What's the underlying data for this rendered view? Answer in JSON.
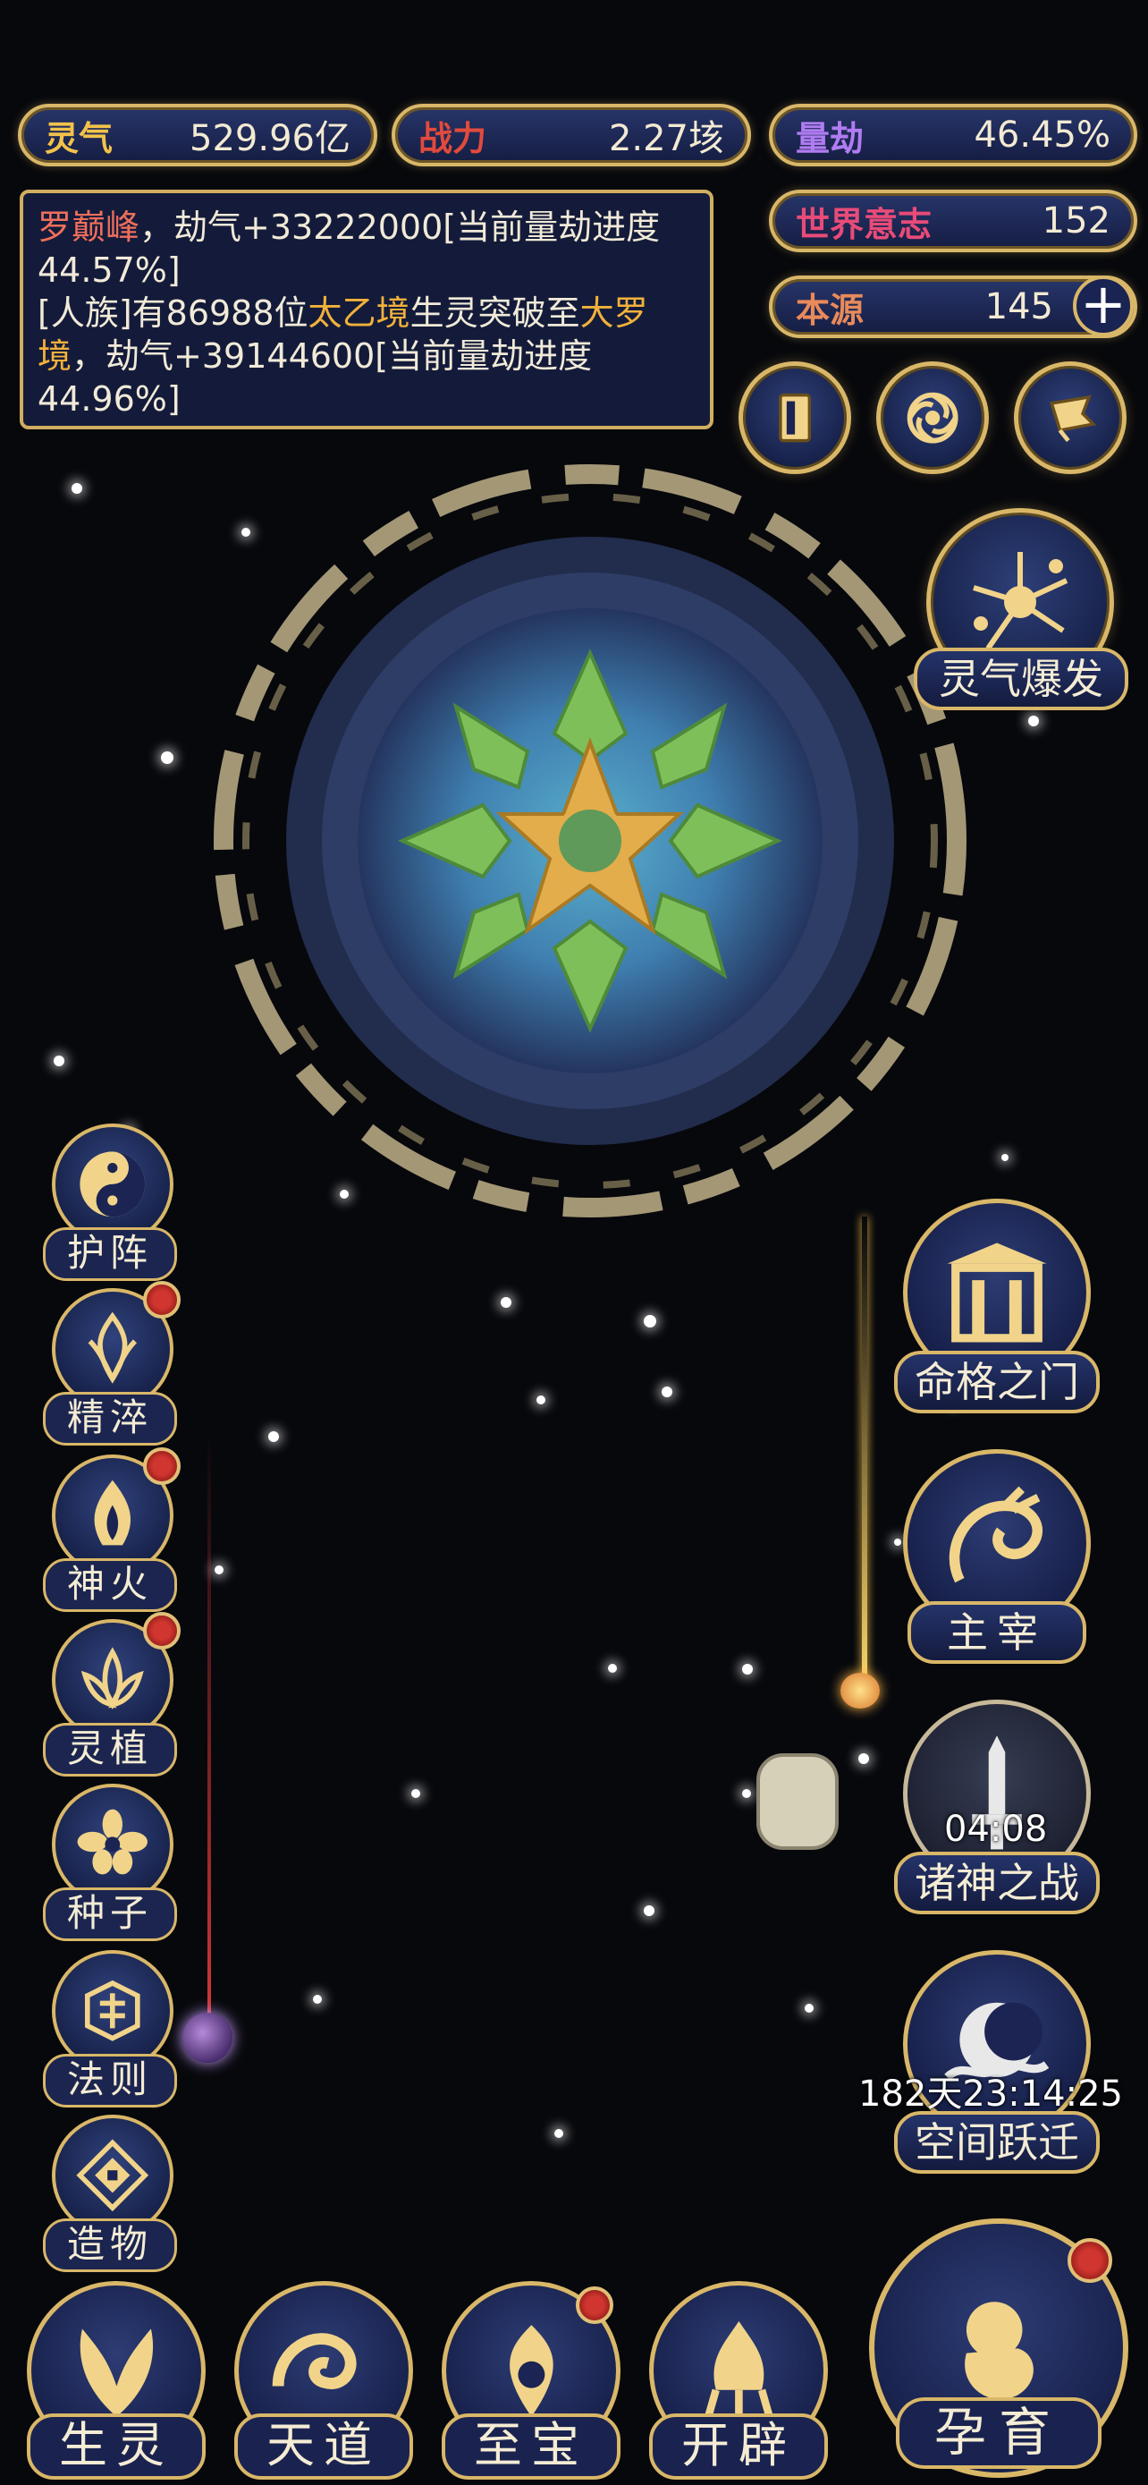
{
  "stats": {
    "lingqi": {
      "label": "灵气",
      "value": "529.96亿",
      "color": "#f2c24a"
    },
    "zhanli": {
      "label": "战力",
      "value": "2.27垓",
      "color": "#e24a3c"
    },
    "liangjie": {
      "label": "量劫",
      "value": "46.45%",
      "color": "#b07cf2"
    },
    "shijie": {
      "label": "世界意志",
      "value": "152",
      "color": "#e84b78"
    },
    "benyuan": {
      "label": "本源",
      "value": "145",
      "color": "#e88a5a"
    }
  },
  "log": {
    "line1_name": "罗巅峰",
    "line1_text": "，劫气+33222000[当前量劫进度44.57%]",
    "line2_prefix": "[人族]有86988位",
    "line2_realm1": "太乙境",
    "line2_mid": "生灵突破至",
    "line2_realm2": "大罗境",
    "line2_suffix": "，劫气+39144600[当前量劫进度44.96%]"
  },
  "top_icons": [
    "card-icon",
    "vortex-icon",
    "flag-icon"
  ],
  "burst": {
    "label": "灵气爆发"
  },
  "left_menu": [
    {
      "label": "护阵",
      "icon": "yin-yang-icon",
      "badge": false
    },
    {
      "label": "精淬",
      "icon": "flame-flower-icon",
      "badge": true
    },
    {
      "label": "神火",
      "icon": "fire-icon",
      "badge": true
    },
    {
      "label": "灵植",
      "icon": "lotus-icon",
      "badge": true
    },
    {
      "label": "种子",
      "icon": "seed-flower-icon",
      "badge": false
    },
    {
      "label": "法则",
      "icon": "rune-icon",
      "badge": false
    },
    {
      "label": "造物",
      "icon": "diamond-rune-icon",
      "badge": false
    }
  ],
  "right_menu": {
    "door": {
      "label": "命格之门"
    },
    "ruler": {
      "label": "主宰"
    },
    "war": {
      "label": "诸神之战",
      "timer": "04:08"
    },
    "leap": {
      "label": "空间跃迁",
      "timer": "182天23:14:25"
    }
  },
  "bottom_menu": [
    {
      "label": "生灵",
      "badge": false
    },
    {
      "label": "天道",
      "badge": false
    },
    {
      "label": "至宝",
      "badge": true
    },
    {
      "label": "开辟",
      "badge": false
    }
  ],
  "nurture": {
    "label": "孕育",
    "badge": true
  }
}
